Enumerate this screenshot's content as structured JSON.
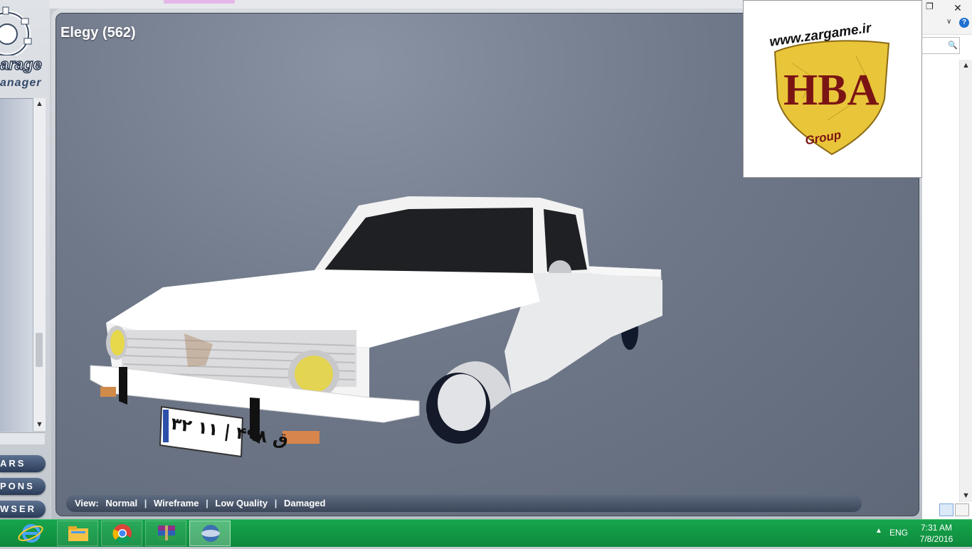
{
  "app": {
    "logo_word": "arage",
    "logo_sub": "anager"
  },
  "left_nav": {
    "buttons": [
      "ARS",
      "PONS",
      "WSER"
    ]
  },
  "viewer": {
    "title": "Elegy (562)",
    "view_bar": {
      "label": "View:",
      "options": [
        "Normal",
        "Wireframe",
        "Low Quality",
        "Damaged"
      ]
    },
    "plate_text": "۳۲ ق ۴۹۸ | ۱۱"
  },
  "watermark": {
    "url": "www.zargame.ir",
    "logo_letters": "HBA",
    "group_text": "Group"
  },
  "right_pane": {
    "restore_icon": "restore-icon",
    "close_icon": "close-icon",
    "help_label": "?"
  },
  "taskbar": {
    "apps": [
      "internet-explorer-icon",
      "file-explorer-icon",
      "chrome-icon",
      "winrar-icon",
      "garage-manager-icon"
    ],
    "lang": "ENG",
    "time": "7:31 AM",
    "date": "7/8/2016"
  },
  "colors": {
    "taskbar": "#0d8a3c",
    "viewer_bg": "#6f7889",
    "view_bar": "#3b4659",
    "nav_button": "#2a3b57"
  }
}
